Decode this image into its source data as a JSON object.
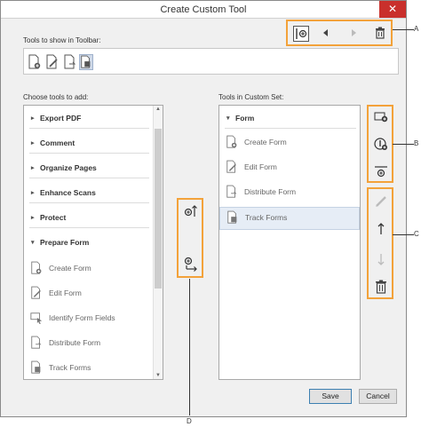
{
  "window": {
    "title": "Create Custom Tool",
    "close_glyph": "✕"
  },
  "toolbar_section": {
    "label": "Tools to show in Toolbar:",
    "icons": [
      "create-form-icon",
      "edit-form-icon",
      "distribute-form-icon",
      "track-forms-icon"
    ]
  },
  "top_controls": [
    "insert-separator-icon",
    "move-left-icon",
    "move-right-icon",
    "trash-icon"
  ],
  "left_panel": {
    "label": "Choose tools to add:",
    "categories": [
      {
        "label": "Export PDF",
        "arrow": "▸"
      },
      {
        "label": "Comment",
        "arrow": "▸"
      },
      {
        "label": "Organize Pages",
        "arrow": "▸"
      },
      {
        "label": "Enhance Scans",
        "arrow": "▸"
      },
      {
        "label": "Protect",
        "arrow": "▸"
      },
      {
        "label": "Prepare Form",
        "arrow": "▾"
      }
    ],
    "tools": [
      {
        "label": "Create Form"
      },
      {
        "label": "Edit Form"
      },
      {
        "label": "Identify Form Fields"
      },
      {
        "label": "Distribute Form"
      },
      {
        "label": "Track Forms"
      }
    ],
    "scroll_up": "▲",
    "scroll_down": "▼"
  },
  "right_panel": {
    "label": "Tools in Custom Set:",
    "category": {
      "label": "Form",
      "arrow": "▾"
    },
    "tools": [
      {
        "label": "Create Form"
      },
      {
        "label": "Edit Form"
      },
      {
        "label": "Distribute Form"
      },
      {
        "label": "Track Forms"
      }
    ]
  },
  "callouts": {
    "a": "A",
    "b": "B",
    "c": "C",
    "d": "D"
  },
  "buttons": {
    "save": "Save",
    "cancel": "Cancel"
  },
  "colors": {
    "callout": "#f3a23a",
    "close": "#c9302c",
    "selection": "#e6edf6"
  }
}
